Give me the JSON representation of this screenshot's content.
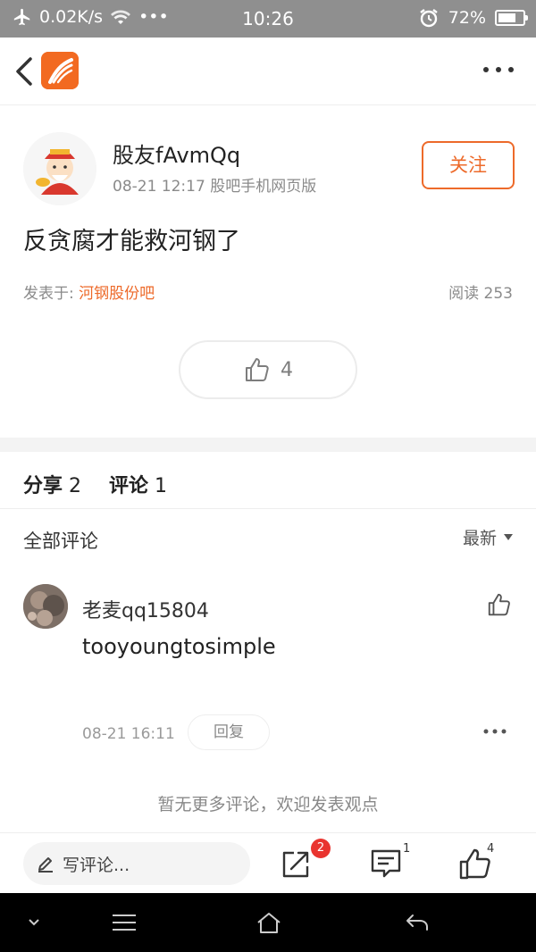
{
  "status_bar": {
    "network_speed": "0.02K/s",
    "more": "•••",
    "time": "10:26",
    "battery_percent": "72%",
    "battery_level": 0.72
  },
  "post": {
    "author": "股友fAvmQq",
    "meta": "08-21 12:17 股吧手机网页版",
    "follow_label": "关注",
    "title": "反贪腐才能救河钢了",
    "posted_in_prefix": "发表于: ",
    "bar_name": "河钢股份吧",
    "reads": "阅读 253",
    "like_count": "4"
  },
  "tabs": {
    "share_label": "分享",
    "share_count": "2",
    "comment_label": "评论",
    "comment_count": "1"
  },
  "comments_header": {
    "all_label": "全部评论",
    "sort_label": "最新"
  },
  "comments": [
    {
      "author": "老麦qq15804",
      "text": "tooyoungtosimple",
      "time": "08-21 16:11",
      "reply_label": "回复"
    }
  ],
  "no_more": "暂无更多评论，欢迎发表观点",
  "bottom_bar": {
    "write_placeholder": "写评论...",
    "share_badge": "2",
    "comment_count": "1",
    "like_count": "4"
  },
  "colors": {
    "accent": "#ed6a2a",
    "badge": "#e9342f"
  }
}
